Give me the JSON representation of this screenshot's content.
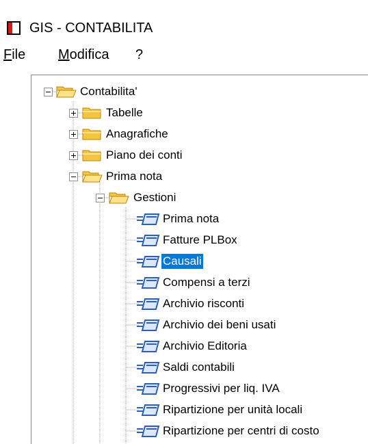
{
  "window": {
    "title": "GIS - CONTABILITA"
  },
  "menu": [
    {
      "label": "File",
      "accel": "F"
    },
    {
      "label": "Modifica",
      "accel": "M"
    },
    {
      "label": "?",
      "accel": ""
    }
  ],
  "tree": {
    "root": {
      "label": "Contabilita'",
      "expanded": true
    },
    "top_level": [
      {
        "label": "Tabelle",
        "expanded": false
      },
      {
        "label": "Anagrafiche",
        "expanded": false
      },
      {
        "label": "Piano dei conti",
        "expanded": false
      },
      {
        "label": "Prima nota",
        "expanded": true
      }
    ],
    "subfolder": {
      "label": "Gestioni",
      "expanded": true
    },
    "leaves": [
      {
        "label": "Prima nota",
        "selected": false
      },
      {
        "label": "Fatture PLBox",
        "selected": false
      },
      {
        "label": "Causali",
        "selected": true
      },
      {
        "label": "Compensi a terzi",
        "selected": false
      },
      {
        "label": "Archivio risconti",
        "selected": false
      },
      {
        "label": "Archivio dei beni usati",
        "selected": false
      },
      {
        "label": "Archivio Editoria",
        "selected": false
      },
      {
        "label": "Saldi contabili",
        "selected": false
      },
      {
        "label": "Progressivi per liq. IVA",
        "selected": false
      },
      {
        "label": "Ripartizione per unità locali",
        "selected": false
      },
      {
        "label": "Ripartizione per centri di costo",
        "selected": false
      }
    ]
  },
  "colors": {
    "selection": "#0078d7",
    "folder": "#f5c542",
    "form_icon": "#2f5fb3",
    "tree_lines": "#a0a0a0"
  }
}
